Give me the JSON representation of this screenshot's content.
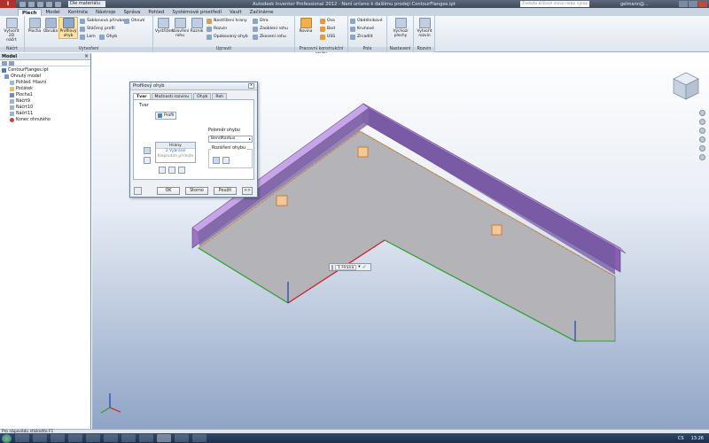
{
  "titlebar": {
    "logo": "I",
    "combo": "Dle materiálu",
    "title": "Autodesk Inventor Professional 2012 - Není určeno k dalšímu prodeji   ContourFlanges.ipt",
    "search_placeholder": "Zadejte klíčové slovo nebo výraz",
    "user": "gelmann@..."
  },
  "tabs": [
    "Plech",
    "Model",
    "Kontrola",
    "Nástroje",
    "Správa",
    "Pohled",
    "Systémové prostředí",
    "Vault",
    "Začínáme"
  ],
  "ribbon": {
    "sketch_group": {
      "label": "Náčrt",
      "create_2d": "Vytvořit\n2D náčrt"
    },
    "create_group": {
      "label": "Vytvoření",
      "plocha": "Plocha",
      "obruba": "Obruba",
      "profilovy_ohyb": "Profilový ohyb",
      "sablonova_prisruba": "Šablonová příruba",
      "staceny_profil": "Stáčený profil",
      "lem": "Lem",
      "ohyb": "Ohyb",
      "ohnuti": "Ohnutí"
    },
    "modify_group": {
      "label": "Upravit",
      "vystrizeni": "Vystřižení",
      "uzavreni_rohu": "Uzavření rohu",
      "razník": "Razník",
      "nastrizeni_hrany": "Nastřižení hrany",
      "rozvin": "Rozvin",
      "opakovany_ohyb": "Opakovaný ohyb",
      "dira": "Díra",
      "zaobleni_rohu": "Zaoblení rohu",
      "zkoseni_rohu": "Zkosení rohu"
    },
    "work_group": {
      "label": "Pracovní konstrukční prvky",
      "rovina": "Rovina",
      "osa": "Osa",
      "bod": "Bod",
      "uss": "USS"
    },
    "pattern_group": {
      "label": "Pole",
      "obdelnikove": "Obdélníkové",
      "kruhove": "Kruhové",
      "zrcadlit": "Zrcadlit"
    },
    "setup_group": {
      "label": "Nastavení",
      "vychozi_plechy": "Výchozí plechy"
    },
    "flat_group": {
      "label": "Rozvin",
      "vytvorit_rozvin": "Vytvořit rozvin"
    }
  },
  "browser": {
    "title": "Model",
    "items": [
      {
        "label": "ContourFlanges.ipt",
        "indent": 0
      },
      {
        "label": "Ohnutý model",
        "indent": 1
      },
      {
        "label": "Pohled: Hlavní",
        "indent": 2
      },
      {
        "label": "Počátek",
        "indent": 2
      },
      {
        "label": "Plocha1",
        "indent": 2
      },
      {
        "label": "Náčrt9",
        "indent": 2
      },
      {
        "label": "Náčrt10",
        "indent": 2
      },
      {
        "label": "Náčrt11",
        "indent": 2
      },
      {
        "label": "Konec ohnutého",
        "indent": 2
      }
    ]
  },
  "dialog": {
    "title": "Profilový ohyb",
    "close": "x",
    "tabs": [
      "Tvar",
      "Možnosti rozvinu",
      "Ohyb",
      "Roh"
    ],
    "shape_label": "Tvar",
    "profile_button": "Profil",
    "edges_header": "Hrany",
    "edges_selected": "2 Vybrané",
    "edges_hint": "Klepnutím přidejte",
    "bend_radius_label": "Poloměr ohybu",
    "bend_radius_value": "BendRadius",
    "bend_extent_label": "Rozšíření ohybu",
    "ok": "OK",
    "cancel": "Storno",
    "apply": "Použít",
    "more": ">>"
  },
  "mini_toolbar": {
    "value": "1 Hrana",
    "ok": "✓"
  },
  "statusbar": {
    "text": "Pro nápovědu stiskněte F1"
  },
  "taskbar": {
    "lang": "CS",
    "time": "13:26"
  },
  "colors": {
    "flange_purple": "#9e73c4",
    "base_gray": "#b3b3b8",
    "accent_orange": "#e0913a",
    "axis_red": "#d11d1d",
    "axis_green": "#29a329",
    "axis_blue": "#1f3fb0"
  }
}
